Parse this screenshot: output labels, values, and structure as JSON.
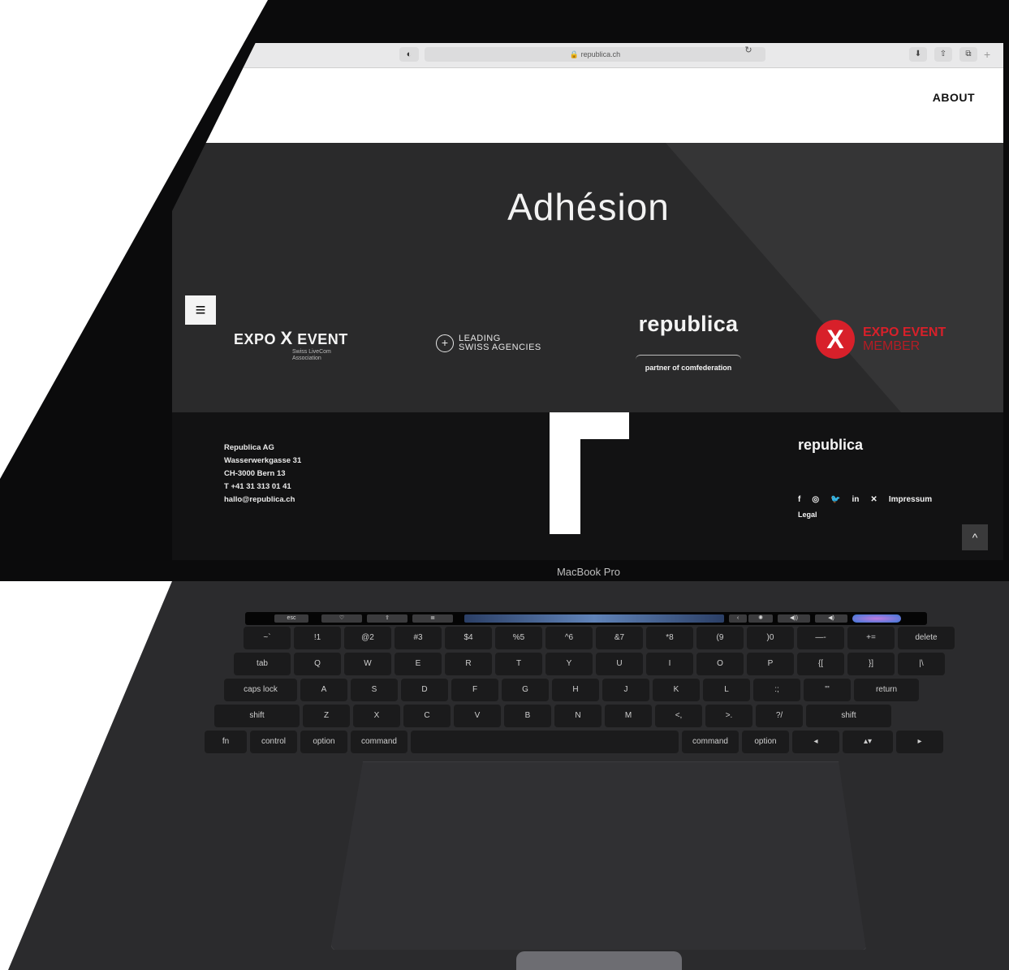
{
  "browser": {
    "url": "republica.ch",
    "icons": [
      "shield-icon",
      "lock-icon",
      "reload-icon",
      "download-icon",
      "share-icon",
      "tabs-icon",
      "new-tab-icon"
    ]
  },
  "site": {
    "nav": {
      "about": "ABOUT",
      "menu_icon": "≡"
    },
    "hero": {
      "title": "Adhésion"
    },
    "logos": {
      "expo_event": {
        "word_left": "EXPO",
        "word_right": "EVENT",
        "sub": "Swiss LiveCom Association"
      },
      "leading": {
        "line1": "LEADING",
        "line2": "SWISS AGENCIES"
      },
      "republica": {
        "word": "republica",
        "tagline": "partner of comfederation"
      },
      "member": {
        "line1": "EXPO EVENT",
        "line2": "MEMBER"
      }
    },
    "footer": {
      "address": [
        "Republica AG",
        "Wasserwerkgasse 31",
        "CH-3000 Bern 13",
        "T +41 31 313 01 41",
        "hallo@republica.ch"
      ],
      "logo": "republica",
      "social": [
        "f",
        "◎",
        "🐦",
        "in",
        "✕"
      ],
      "impressum": "Impressum",
      "legal": "Legal",
      "scroll_top": "^"
    }
  },
  "device": {
    "label": "MacBook Pro"
  },
  "keyboard": {
    "touchbar": [
      "esc"
    ],
    "rows": [
      [
        "~`",
        "!1",
        "@2",
        "#3",
        "$4",
        "%5",
        "^6",
        "&7",
        "*8",
        "(9",
        ")0",
        "—-",
        "+=",
        "delete"
      ],
      [
        "tab",
        "Q",
        "W",
        "E",
        "R",
        "T",
        "Y",
        "U",
        "I",
        "O",
        "P",
        "{[",
        "}]",
        "|\\"
      ],
      [
        "caps lock",
        "A",
        "S",
        "D",
        "F",
        "G",
        "H",
        "J",
        "K",
        "L",
        ":;",
        "\"'",
        "return"
      ],
      [
        "shift",
        "Z",
        "X",
        "C",
        "V",
        "B",
        "N",
        "M",
        "<,",
        ">.",
        "?/",
        "shift"
      ],
      [
        "fn",
        "control",
        "option",
        "command",
        "",
        "command",
        "option",
        "◂",
        "▴▾",
        "▸"
      ]
    ]
  }
}
